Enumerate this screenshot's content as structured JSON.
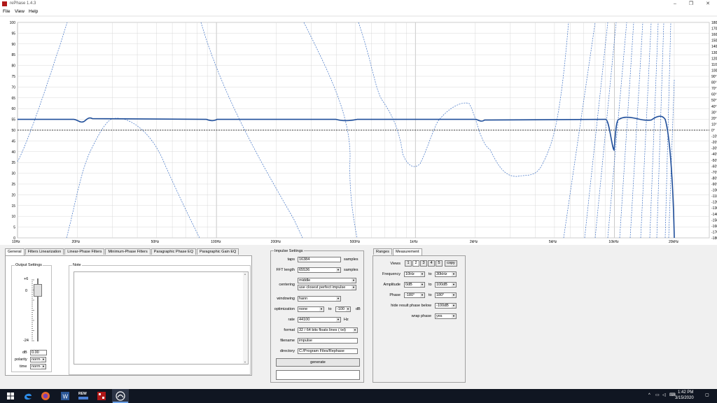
{
  "window": {
    "title": "rePhase 1.4.3",
    "minimize": "–",
    "maximize": "❐",
    "close": "✕"
  },
  "menu": [
    "File",
    "View",
    "Help"
  ],
  "plot": {
    "left_ticks": [
      "100",
      "95",
      "90",
      "85",
      "80",
      "75",
      "70",
      "65",
      "60",
      "55",
      "50",
      "45",
      "40",
      "35",
      "30",
      "25",
      "20",
      "15",
      "10",
      "5",
      "0"
    ],
    "right_ticks": [
      "180°",
      "170°",
      "160°",
      "150°",
      "140°",
      "130°",
      "120°",
      "110°",
      "100°",
      "90°",
      "80°",
      "70°",
      "60°",
      "50°",
      "40°",
      "30°",
      "20°",
      "10°",
      "0°",
      "-10°",
      "-20°",
      "-30°",
      "-40°",
      "-50°",
      "-60°",
      "-70°",
      "-80°",
      "-90°",
      "-100°",
      "-110°",
      "-120°",
      "-130°",
      "-140°",
      "-150°",
      "-160°",
      "-170°",
      "-180°"
    ],
    "freq_ticks": [
      "10Hz",
      "20Hz",
      "50Hz",
      "100Hz",
      "200Hz",
      "500Hz",
      "1kHz",
      "2kHz",
      "5kHz",
      "10kHz",
      "20kHz"
    ],
    "colors": {
      "curve": "#1f4e9a",
      "phase": "#3b6fc4",
      "grid": "#d8d8d8",
      "grid_major": "#bdbdbd"
    }
  },
  "tabs": [
    "General",
    "Filters Linearization",
    "Linear-Phase Filters",
    "Minimum-Phase Filters",
    "Paragraphic Phase EQ",
    "Paragraphic Gain EQ"
  ],
  "output_settings": {
    "label": "Output Settings",
    "slider_top": "+6",
    "slider_zero": "0",
    "slider_bottom": "-24",
    "db_label": "dB",
    "db_value": "0.00",
    "polarity_label": "polarity",
    "polarity_value": "norm",
    "time_label": "time",
    "time_value": "norm"
  },
  "note": {
    "label": "Note",
    "text": ""
  },
  "impulse": {
    "label": "Impulse Settings",
    "taps_label": "taps",
    "taps_value": "16384",
    "taps_unit": "samples",
    "fft_label": "FFT length",
    "fft_value": "65536",
    "fft_unit": "samples",
    "centering_label": "centering",
    "centering_value": "middle",
    "centering_sub": "use closest perfect impulse",
    "windowing_label": "windowing",
    "windowing_value": "hann",
    "optimization_label": "optimization",
    "optimization_value": "none",
    "optimization_to": "to",
    "optimization_db": "-100",
    "optimization_unit": "dB",
    "rate_label": "rate",
    "rate_value": "44100",
    "rate_unit": "Hz",
    "format_label": "format",
    "format_value": "32 / 64 bits floats lines ( txt)",
    "filename_label": "filename",
    "filename_value": "impulse",
    "directory_label": "directory",
    "directory_value": "C:/Program Files/Rephase",
    "generate": "generate"
  },
  "ranges": {
    "tabs": [
      "Ranges",
      "Measurement"
    ],
    "views_label": "Views",
    "views": [
      "1",
      "2",
      "3",
      "4",
      "5"
    ],
    "copy": "copy",
    "frequency_label": "Frequency",
    "frequency_from": "10Hz",
    "frequency_to": "30kHz",
    "amplitude_label": "Amplitude",
    "amplitude_from": "0dB",
    "amplitude_to": "100dB",
    "phase_label": "Phase",
    "phase_from": "-180°",
    "phase_to": "180°",
    "to": "to",
    "hide_label": "hide result phase below",
    "hide_value": "-100dB",
    "wrap_label": "wrap phase",
    "wrap_value": "yes"
  },
  "taskbar": {
    "time": "1:42 PM",
    "date": "3/15/2020",
    "rew_label": "REW"
  }
}
